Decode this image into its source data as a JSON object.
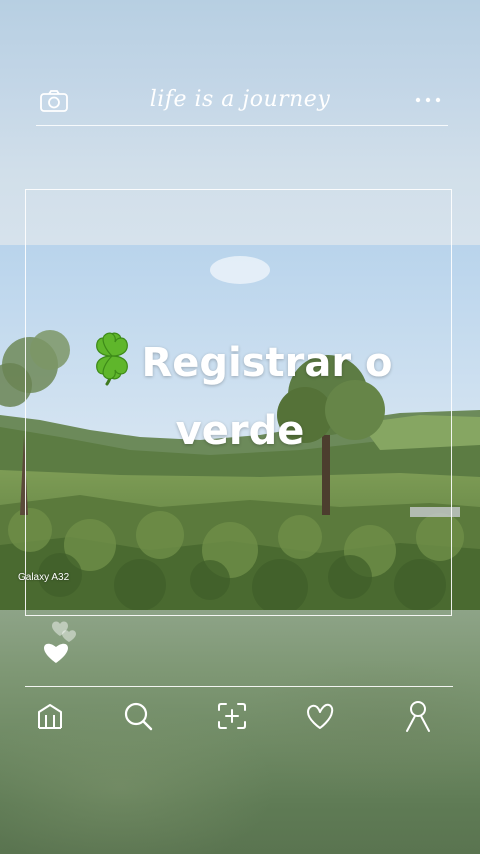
{
  "header": {
    "title": "life is a journey",
    "left_icon": "camera-icon",
    "right_icon": "more-dots-icon"
  },
  "post": {
    "caption_emoji": "four-leaf-clover-icon",
    "caption": "Registrar o verde",
    "device_label": "Galaxy A32"
  },
  "like": {
    "icon": "heart-icon"
  },
  "nav": {
    "items": [
      {
        "icon": "home-icon"
      },
      {
        "icon": "search-icon"
      },
      {
        "icon": "add-photo-icon"
      },
      {
        "icon": "heart-outline-icon"
      },
      {
        "icon": "profile-icon"
      }
    ]
  },
  "colors": {
    "sky": "#c3d6e7",
    "vegetation": "#6f8a64",
    "line": "#ffffff"
  }
}
